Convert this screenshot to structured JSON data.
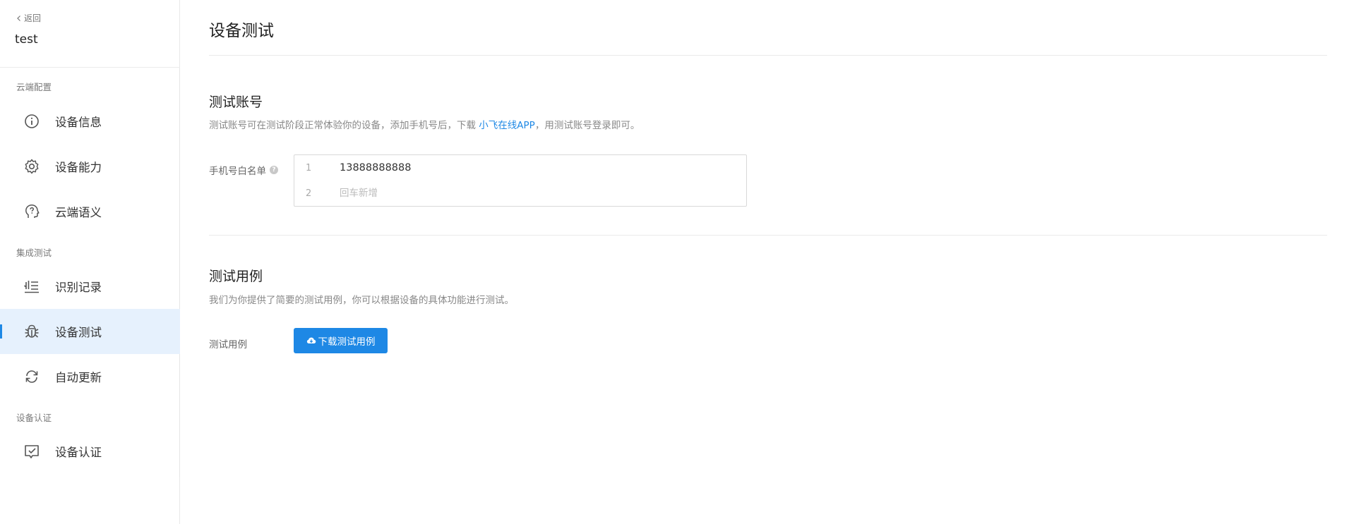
{
  "sidebar": {
    "back_label": "返回",
    "project_name": "test",
    "sections": [
      {
        "label": "云端配置"
      },
      {
        "label": "集成测试"
      },
      {
        "label": "设备认证"
      }
    ],
    "items": [
      {
        "label": "设备信息",
        "icon": "info-circle-icon"
      },
      {
        "label": "设备能力",
        "icon": "gear-icon"
      },
      {
        "label": "云端语义",
        "icon": "head-question-icon"
      },
      {
        "label": "识别记录",
        "icon": "record-list-icon"
      },
      {
        "label": "设备测试",
        "icon": "bug-icon",
        "active": true
      },
      {
        "label": "自动更新",
        "icon": "refresh-icon"
      },
      {
        "label": "设备认证",
        "icon": "certificate-icon"
      }
    ]
  },
  "main": {
    "title": "设备测试",
    "test_account": {
      "title": "测试账号",
      "desc_prefix": "测试账号可在测试阶段正常体验你的设备，添加手机号后，下载 ",
      "desc_link": "小飞在线APP",
      "desc_suffix": "，用测试账号登录即可。",
      "whitelist_label": "手机号白名单",
      "rows": [
        {
          "num": "1",
          "value": "13888888888"
        },
        {
          "num": "2",
          "placeholder": "回车新增"
        }
      ]
    },
    "test_cases": {
      "title": "测试用例",
      "desc": "我们为你提供了简要的测试用例，你可以根据设备的具体功能进行测试。",
      "field_label": "测试用例",
      "download_label": "下载测试用例"
    }
  },
  "colors": {
    "accent": "#1e88e5",
    "active_bg": "#e6f1fd"
  }
}
